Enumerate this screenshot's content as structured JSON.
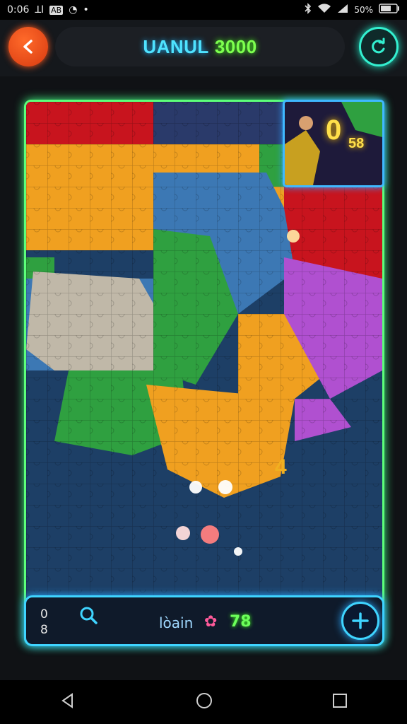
{
  "status_bar": {
    "time": "0:06",
    "left_glyphs": "ꓕI",
    "left_badge": "AB",
    "dot": "•",
    "battery_text": "50%",
    "icons": [
      "bluetooth-icon",
      "wifi-icon",
      "signal-icon",
      "battery-icon"
    ]
  },
  "header": {
    "title_part1": "UANUL",
    "title_part2": "3000",
    "back_icon": "arrow-left-icon",
    "hint_icon": "refresh-icon"
  },
  "preview": {
    "score": "0",
    "sub_score": "58"
  },
  "board": {
    "floating_piece": "4"
  },
  "bottom_bar": {
    "counter_top": "0",
    "counter_bottom": "8",
    "search_icon": "magnifier-icon",
    "pieces_label": "lòain",
    "flower_icon": "flower-icon",
    "flower_glyph": "✿",
    "pieces_count": "78",
    "add_icon": "plus-icon"
  },
  "nav": {
    "items": [
      "back-nav",
      "home-nav",
      "recents-nav"
    ]
  },
  "colors": {
    "red": "#c8141e",
    "orange": "#f0a020",
    "green": "#2fa040",
    "blue": "#3c78b4",
    "purple": "#b050d0",
    "sea": "#1d3f66",
    "neon_green": "#5cff7a",
    "neon_cyan": "#3fd4ff"
  }
}
